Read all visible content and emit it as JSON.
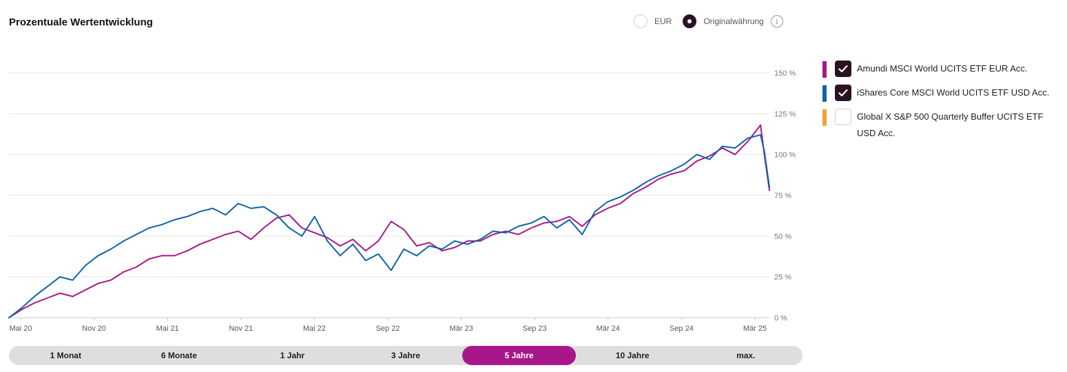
{
  "title": "Prozentuale Wertentwicklung",
  "currency": {
    "options": [
      {
        "label": "EUR",
        "checked": false
      },
      {
        "label": "Originalwährung",
        "checked": true
      }
    ],
    "info_icon": "info-icon"
  },
  "legend": [
    {
      "label": "Amundi MSCI World UCITS ETF EUR Acc.",
      "color": "#a8178a",
      "checked": true
    },
    {
      "label": "iShares Core MSCI World UCITS ETF USD Acc.",
      "color": "#0d64a6",
      "checked": true
    },
    {
      "label": "Global X S&P 500 Quarterly Buffer UCITS ETF USD Acc.",
      "color": "#f5a033",
      "checked": false
    }
  ],
  "periods": [
    {
      "label": "1 Monat",
      "active": false
    },
    {
      "label": "6 Monate",
      "active": false
    },
    {
      "label": "1 Jahr",
      "active": false
    },
    {
      "label": "3 Jahre",
      "active": false
    },
    {
      "label": "5 Jahre",
      "active": true
    },
    {
      "label": "10 Jahre",
      "active": false
    },
    {
      "label": "max.",
      "active": false
    }
  ],
  "chart_data": {
    "type": "line",
    "x_range": [
      "2020-04",
      "2025-03"
    ],
    "xticks": [
      "Mai 20",
      "Nov 20",
      "Mai 21",
      "Nov 21",
      "Mai 22",
      "Sep 22",
      "Mär 23",
      "Sep 23",
      "Mär 24",
      "Sep 24",
      "Mär 25"
    ],
    "ytick_labels": [
      "0 %",
      "25 %",
      "50 %",
      "75 %",
      "100 %",
      "125 %",
      "150 %"
    ],
    "ylim": [
      0,
      150
    ],
    "grid": true,
    "x_months": [
      0,
      1,
      2,
      3,
      4,
      5,
      6,
      7,
      8,
      9,
      10,
      11,
      12,
      13,
      14,
      15,
      16,
      17,
      18,
      19,
      20,
      21,
      22,
      23,
      24,
      25,
      26,
      27,
      28,
      29,
      30,
      31,
      32,
      33,
      34,
      35,
      36,
      37,
      38,
      39,
      40,
      41,
      42,
      43,
      44,
      45,
      46,
      47,
      48,
      49,
      50,
      51,
      52,
      53,
      54,
      55,
      56,
      57,
      58,
      59,
      59.3,
      59.7
    ],
    "series": [
      {
        "name": "Amundi MSCI World UCITS ETF EUR Acc.",
        "color": "#a8178a",
        "values": [
          0,
          5,
          9,
          12,
          15,
          13,
          17,
          21,
          23,
          28,
          31,
          36,
          38,
          38,
          41,
          45,
          48,
          51,
          53,
          48,
          55,
          61,
          63,
          55,
          52,
          49,
          44,
          48,
          41,
          47,
          59,
          54,
          44,
          46,
          41,
          43,
          47,
          47,
          51,
          53,
          51,
          55,
          58,
          59,
          62,
          56,
          63,
          67,
          70,
          76,
          80,
          85,
          88,
          90,
          96,
          99,
          104,
          100,
          108,
          118,
          100,
          78
        ]
      },
      {
        "name": "iShares Core MSCI World UCITS ETF USD Acc.",
        "color": "#0d64a6",
        "values": [
          0,
          6,
          13,
          19,
          25,
          23,
          32,
          38,
          42,
          47,
          51,
          55,
          57,
          60,
          62,
          65,
          67,
          63,
          70,
          67,
          68,
          63,
          55,
          50,
          62,
          47,
          38,
          45,
          35,
          39,
          29,
          42,
          38,
          44,
          42,
          47,
          45,
          48,
          53,
          52,
          56,
          58,
          62,
          55,
          60,
          51,
          65,
          71,
          74,
          78,
          83,
          87,
          90,
          94,
          100,
          97,
          105,
          104,
          110,
          112,
          102,
          80
        ]
      }
    ]
  }
}
